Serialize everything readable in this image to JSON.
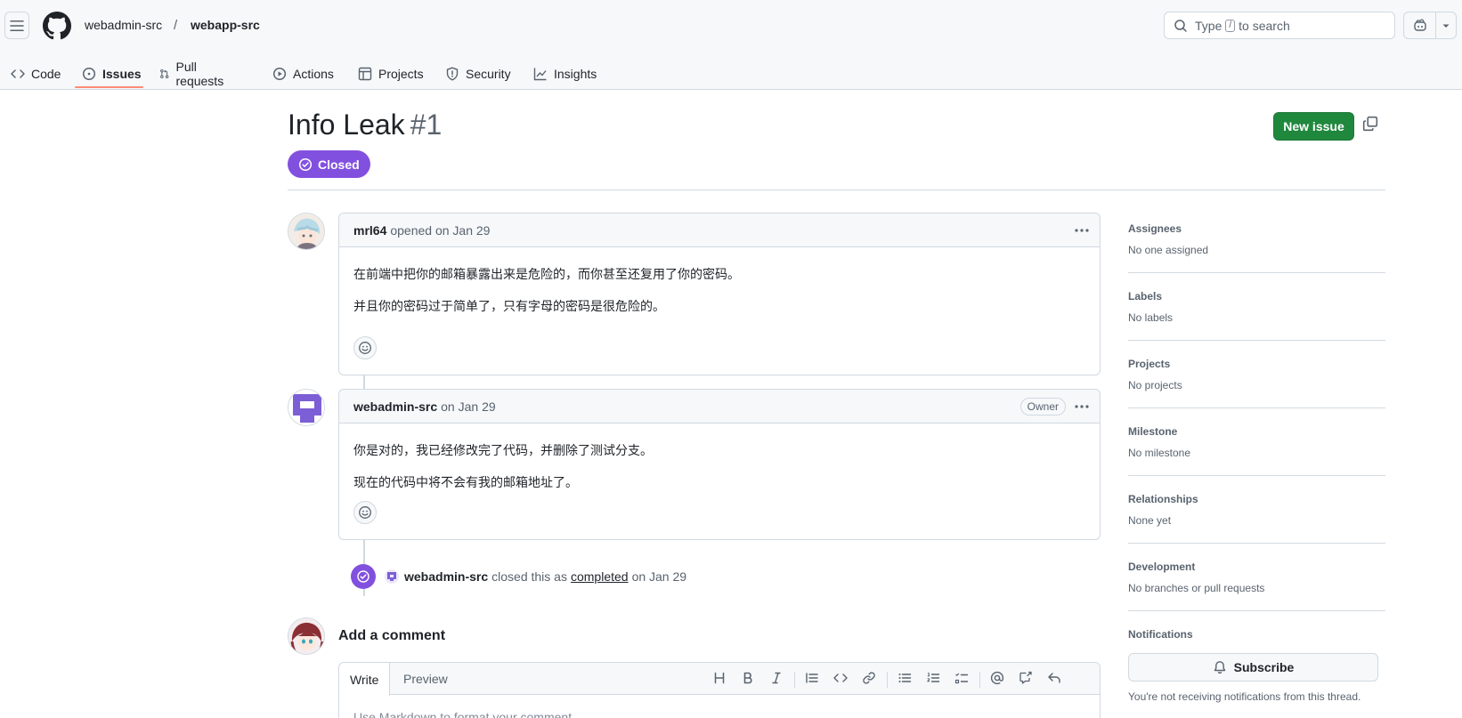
{
  "header": {
    "owner": "webadmin-src",
    "separator": "/",
    "repo": "webapp-src",
    "search_prefix": "Type",
    "search_key": "/",
    "search_suffix": "to search"
  },
  "tabs": [
    {
      "label": "Code",
      "icon": "code-icon"
    },
    {
      "label": "Issues",
      "icon": "issue-opened-icon",
      "active": true
    },
    {
      "label": "Pull requests",
      "icon": "git-pull-request-icon"
    },
    {
      "label": "Actions",
      "icon": "play-icon"
    },
    {
      "label": "Projects",
      "icon": "table-icon"
    },
    {
      "label": "Security",
      "icon": "shield-icon"
    },
    {
      "label": "Insights",
      "icon": "graph-icon"
    }
  ],
  "issue": {
    "title": "Info Leak",
    "number": "#1",
    "state": "Closed",
    "new_issue_label": "New issue"
  },
  "comments": [
    {
      "author": "mrl64",
      "meta": "opened on Jan 29",
      "paragraphs": [
        "在前端中把你的邮箱暴露出来是危险的，而你甚至还复用了你的密码。",
        "并且你的密码过于简单了，只有字母的密码是很危险的。"
      ]
    },
    {
      "author": "webadmin-src",
      "meta": "on Jan 29",
      "badge": "Owner",
      "paragraphs": [
        "你是对的，我已经修改完了代码，并删除了测试分支。",
        "现在的代码中将不会有我的邮箱地址了。"
      ]
    }
  ],
  "event": {
    "author": "webadmin-src",
    "text1": "closed this as",
    "link": "completed",
    "text2": "on Jan 29"
  },
  "composer": {
    "title": "Add a comment",
    "tab_write": "Write",
    "tab_preview": "Preview",
    "placeholder": "Use Markdown to format your comment"
  },
  "sidebar": {
    "assignees": {
      "label": "Assignees",
      "value": "No one assigned"
    },
    "labels": {
      "label": "Labels",
      "value": "No labels"
    },
    "projects": {
      "label": "Projects",
      "value": "No projects"
    },
    "milestone": {
      "label": "Milestone",
      "value": "No milestone"
    },
    "relationships": {
      "label": "Relationships",
      "value": "None yet"
    },
    "development": {
      "label": "Development",
      "value": "No branches or pull requests"
    },
    "notifications": {
      "label": "Notifications",
      "button": "Subscribe",
      "note": "You're not receiving notifications from this thread."
    }
  },
  "colors": {
    "accent_purple": "#8250df",
    "primary_green": "#1f883d",
    "tab_underline": "#fd8c73"
  }
}
